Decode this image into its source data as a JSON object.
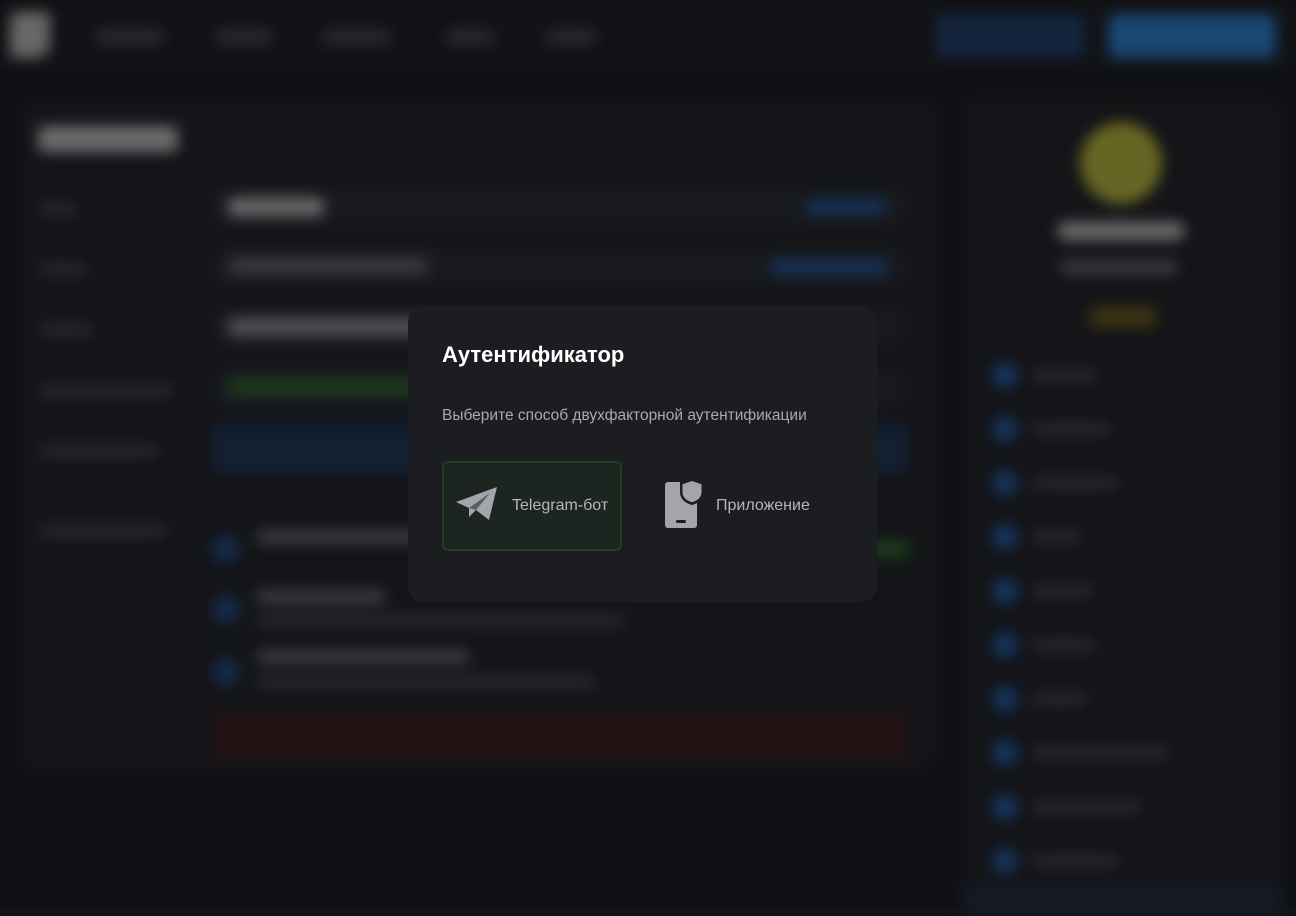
{
  "modal": {
    "title": "Аутентификатор",
    "subtitle": "Выберите способ двухфакторной аутентификации",
    "options": [
      {
        "label": "Telegram-бот",
        "icon": "telegram-icon",
        "selected": true
      },
      {
        "label": "Приложение",
        "icon": "phone-shield-icon",
        "selected": false
      }
    ]
  },
  "colors": {
    "modal_bg": "#1c1d21",
    "page_bg": "#121316",
    "selected_border": "#223d25",
    "accent_blue": "#2a84df",
    "icon_gray": "#a3a5aa"
  }
}
